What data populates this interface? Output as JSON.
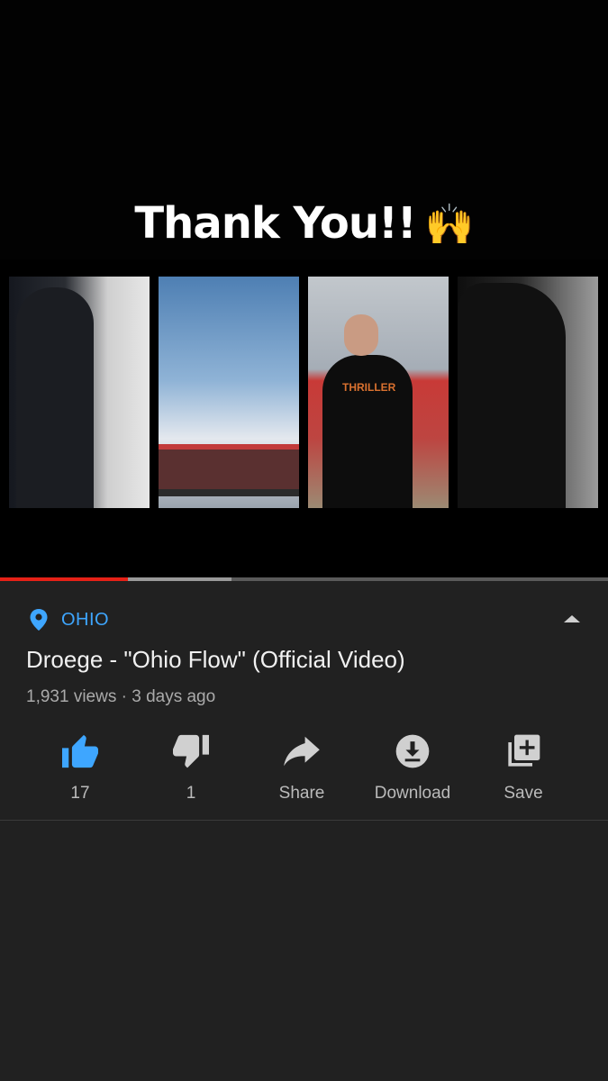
{
  "overlay": {
    "text": "Thank You!!",
    "emoji": "🙌"
  },
  "video": {
    "shirt_text": "THRILLER",
    "played_fraction": 0.21,
    "buffered_fraction": 0.38
  },
  "info": {
    "location": "OHIO",
    "title": "Droege - \"Ohio Flow\" (Official Video)",
    "meta": "1,931 views · 3 days ago"
  },
  "actions": {
    "like_count": "17",
    "dislike_count": "1",
    "share_label": "Share",
    "download_label": "Download",
    "save_label": "Save"
  },
  "colors": {
    "accent": "#3ea6ff",
    "progress": "#e62117",
    "panel_bg": "#212121"
  }
}
